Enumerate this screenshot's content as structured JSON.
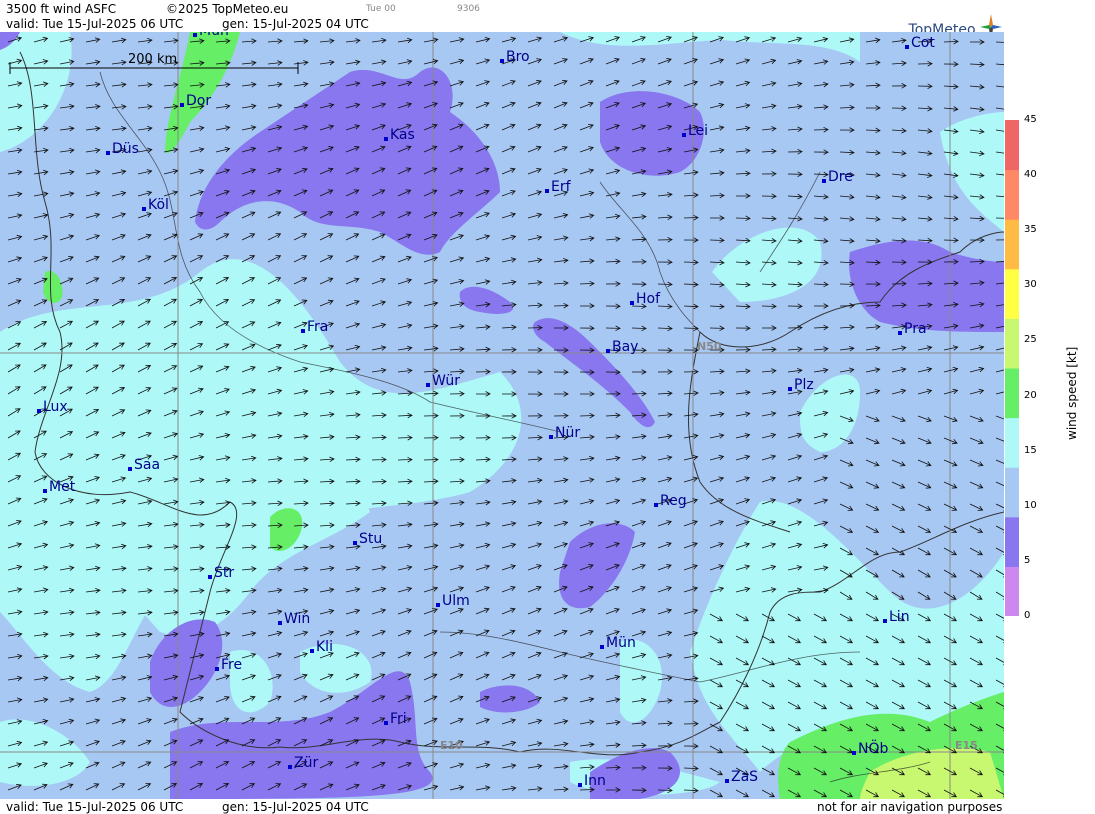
{
  "header": {
    "product": "3500 ft wind ASFC",
    "copyright": "©2025 TopMeteo.eu",
    "run_label": "Tue 00",
    "code": "9306",
    "valid": "valid:  Tue  15-Jul-2025  06 UTC",
    "gen": "gen: 15-Jul-2025 04 UTC",
    "brand": "TopMeteo"
  },
  "scale_bar": {
    "label": "200 km"
  },
  "grid_labels": {
    "lat": "N50",
    "lon1": "E10",
    "lon2": "E15"
  },
  "cities": [
    {
      "name": "Mün"
    },
    {
      "name": "Bro"
    },
    {
      "name": "Cot"
    },
    {
      "name": "Dor"
    },
    {
      "name": "Kas"
    },
    {
      "name": "Lei"
    },
    {
      "name": "Düs"
    },
    {
      "name": "Erf"
    },
    {
      "name": "Dre"
    },
    {
      "name": "Köl"
    },
    {
      "name": "Hof"
    },
    {
      "name": "Fra"
    },
    {
      "name": "Pra"
    },
    {
      "name": "Bay"
    },
    {
      "name": "Wür"
    },
    {
      "name": "Plz"
    },
    {
      "name": "Lux"
    },
    {
      "name": "Nür"
    },
    {
      "name": "Saa"
    },
    {
      "name": "Met"
    },
    {
      "name": "Reg"
    },
    {
      "name": "Stu"
    },
    {
      "name": "Str"
    },
    {
      "name": "Ulm"
    },
    {
      "name": "Win"
    },
    {
      "name": "Lin"
    },
    {
      "name": "Kli"
    },
    {
      "name": "Mün"
    },
    {
      "name": "Fre"
    },
    {
      "name": "Fri"
    },
    {
      "name": "NÖb"
    },
    {
      "name": "Zür"
    },
    {
      "name": "ZaS"
    },
    {
      "name": "Inn"
    }
  ],
  "legend": {
    "title": "wind speed [kt]",
    "ticks": [
      "0",
      "5",
      "10",
      "15",
      "20",
      "25",
      "30",
      "35",
      "40",
      "45"
    ],
    "colors": [
      "#cc88ee",
      "#8877ee",
      "#a8c8f4",
      "#aef8f8",
      "#66ee66",
      "#c8f870",
      "#ffff44",
      "#ffbb44",
      "#ff8866",
      "#ee6666"
    ]
  },
  "footer": {
    "valid": "valid:  Tue  15-Jul-2025  06 UTC",
    "gen": "gen: 15-Jul-2025 04 UTC",
    "note": "not for air navigation purposes"
  }
}
